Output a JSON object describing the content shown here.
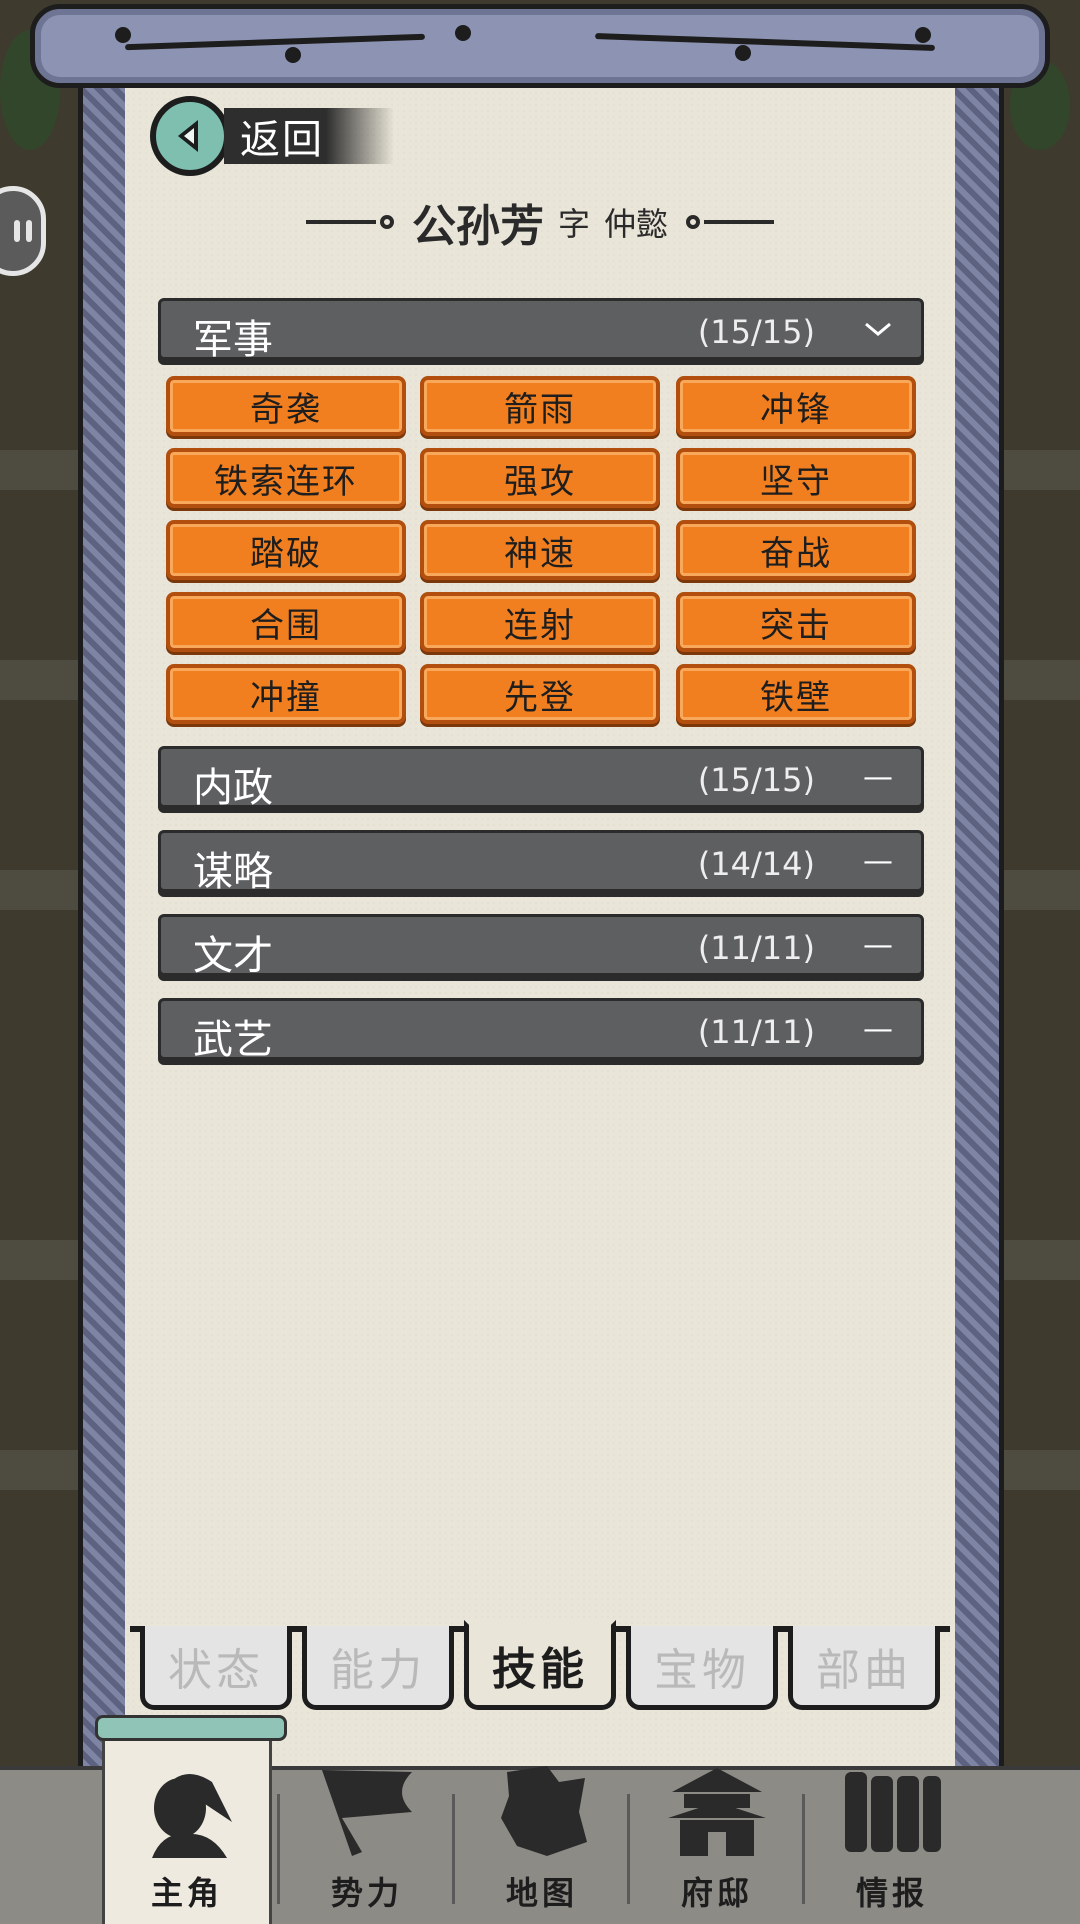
{
  "back": {
    "label": "返回"
  },
  "character": {
    "name": "公孙芳",
    "zi_label": "字",
    "courtesy_name": "仲懿"
  },
  "categories": [
    {
      "label": "军事",
      "count": "(15/15)",
      "toggle": "﹀",
      "expanded": true
    },
    {
      "label": "内政",
      "count": "(15/15)",
      "toggle": "—",
      "expanded": false
    },
    {
      "label": "谋略",
      "count": "(14/14)",
      "toggle": "—",
      "expanded": false
    },
    {
      "label": "文才",
      "count": "(11/11)",
      "toggle": "—",
      "expanded": false
    },
    {
      "label": "武艺",
      "count": "(11/11)",
      "toggle": "—",
      "expanded": false
    }
  ],
  "military_skills": [
    "奇袭",
    "箭雨",
    "冲锋",
    "铁索连环",
    "强攻",
    "坚守",
    "踏破",
    "神速",
    "奋战",
    "合围",
    "连射",
    "突击",
    "冲撞",
    "先登",
    "铁壁"
  ],
  "tabs": [
    {
      "label": "状态",
      "active": false
    },
    {
      "label": "能力",
      "active": false
    },
    {
      "label": "技能",
      "active": true
    },
    {
      "label": "宝物",
      "active": false
    },
    {
      "label": "部曲",
      "active": false
    }
  ],
  "nav": [
    {
      "label": "主角",
      "icon": "hero-portrait-icon",
      "active": true
    },
    {
      "label": "势力",
      "icon": "faction-flag-icon",
      "active": false
    },
    {
      "label": "地图",
      "icon": "map-icon",
      "active": false
    },
    {
      "label": "府邸",
      "icon": "mansion-icon",
      "active": false
    },
    {
      "label": "情报",
      "icon": "intel-scrolls-icon",
      "active": false
    }
  ],
  "colors": {
    "skill_fill": "#f17f1f",
    "header_fill": "#5e5f61",
    "paper": "#e9e5d8",
    "accent_teal": "#7ebfaf"
  }
}
